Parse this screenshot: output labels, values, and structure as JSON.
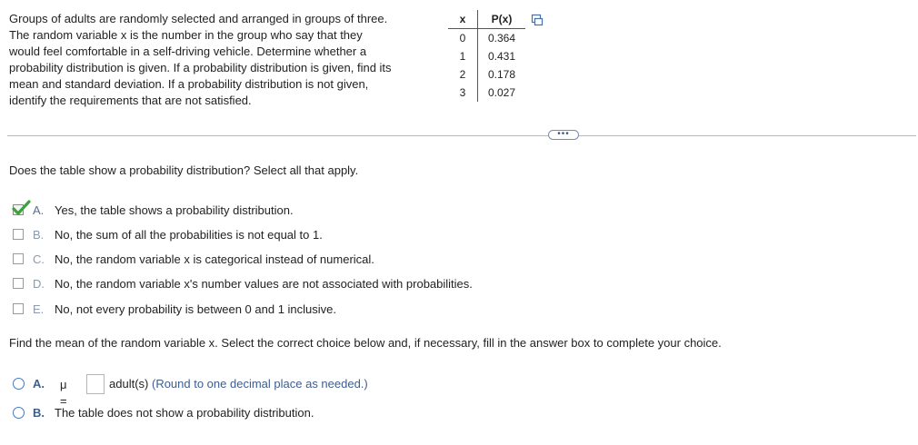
{
  "problem": {
    "lines": [
      "Groups of adults are randomly selected and arranged in groups of three.",
      "The random variable x is the number in the group who say that they",
      "would feel comfortable in a self-driving vehicle. Determine whether a",
      "probability distribution is given. If a probability distribution is given, find its",
      "mean and standard deviation. If a probability distribution is not given,",
      "identify the requirements that are not satisfied."
    ]
  },
  "table": {
    "headers": [
      "x",
      "P(x)"
    ],
    "rows": [
      [
        "0",
        "0.364"
      ],
      [
        "1",
        "0.431"
      ],
      [
        "2",
        "0.178"
      ],
      [
        "3",
        "0.027"
      ]
    ]
  },
  "icons": {
    "copy": "copy-icon",
    "more": "more-dots-icon",
    "check": "green-checkmark-icon"
  },
  "more_button": {
    "label": "•••"
  },
  "colors": {
    "accent_blue": "#3d5d8f",
    "check_green": "#3aa33a",
    "divider": "#b8b8b8"
  },
  "question1": {
    "prompt": "Does the table show a probability distribution? Select all that apply.",
    "options": [
      {
        "letter": "A.",
        "text": "Yes, the table shows a probability distribution.",
        "checked": true
      },
      {
        "letter": "B.",
        "text": "No, the sum of all the probabilities is not equal to 1.",
        "checked": false
      },
      {
        "letter": "C.",
        "text": "No, the random variable x is categorical instead of numerical.",
        "checked": false
      },
      {
        "letter": "D.",
        "text": "No, the random variable x's number values are not associated with probabilities.",
        "checked": false
      },
      {
        "letter": "E.",
        "text": "No, not every probability is between 0 and 1 inclusive.",
        "checked": false
      }
    ]
  },
  "question2": {
    "prompt": "Find the mean of the random variable x. Select the correct choice below and, if necessary, fill in the answer box to complete your choice.",
    "optionA": {
      "letter": "A.",
      "symbol": "μ =",
      "value": "",
      "unit": "adult(s)",
      "hint": "(Round to one decimal place as needed.)"
    },
    "optionB": {
      "letter": "B.",
      "text": "The table does not show a probability distribution."
    }
  }
}
